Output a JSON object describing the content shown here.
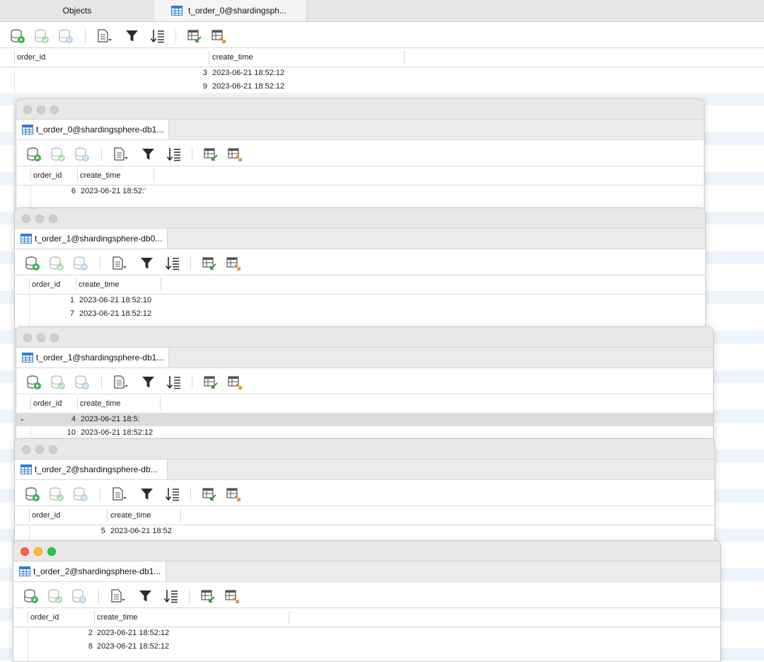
{
  "main": {
    "tabs": [
      {
        "label": "Objects"
      },
      {
        "label": "t_order_0@shardingsph..."
      }
    ],
    "columns": [
      "order_id",
      "create_time"
    ],
    "rows": [
      {
        "order_id": "3",
        "create_time": "2023-06-21 18:52:12"
      },
      {
        "order_id": "9",
        "create_time": "2023-06-21 18:52:12"
      }
    ]
  },
  "windows": [
    {
      "tab": "t_order_0@shardingsphere-db1...",
      "columns": [
        "order_id",
        "create_time"
      ],
      "rows": [
        {
          "order_id": "6",
          "create_time": "2023-06-21 18:52:’"
        }
      ]
    },
    {
      "tab": "t_order_1@shardingsphere-db0...",
      "columns": [
        "order_id",
        "create_time"
      ],
      "rows": [
        {
          "order_id": "1",
          "create_time": "2023-06-21 18:52:10"
        },
        {
          "order_id": "7",
          "create_time": "2023-06-21 18:52:12"
        }
      ]
    },
    {
      "tab": "t_order_1@shardingsphere-db1...",
      "columns": [
        "order_id",
        "create_time"
      ],
      "rows": [
        {
          "order_id": "4",
          "create_time": "2023-06-21 18:5:"
        },
        {
          "order_id": "10",
          "create_time": "2023-06-21 18:52:12"
        }
      ]
    },
    {
      "tab": "t_order_2@shardingsphere-db...",
      "columns": [
        "order_id",
        "create_time"
      ],
      "rows": [
        {
          "order_id": "5",
          "create_time": "2023-06-21 18:52"
        }
      ]
    },
    {
      "tab": "t_order_2@shardingsphere-db1...",
      "columns": [
        "order_id",
        "create_time"
      ],
      "rows": [
        {
          "order_id": "2",
          "create_time": "2023-06-21 18:52:12"
        },
        {
          "order_id": "8",
          "create_time": "2023-06-21 18:52:12"
        }
      ]
    }
  ],
  "toolbar_icons": [
    "begin-transaction-icon",
    "commit-icon",
    "rollback-icon",
    "text-view-icon",
    "filter-icon",
    "sort-icon",
    "import-icon",
    "export-icon"
  ],
  "colors": {
    "accent_table_icon": "#2f7fd1",
    "go_green": "#3fb34f",
    "active_close": "#fe5f57",
    "active_minimize": "#febc2e",
    "active_zoom": "#28c840"
  }
}
